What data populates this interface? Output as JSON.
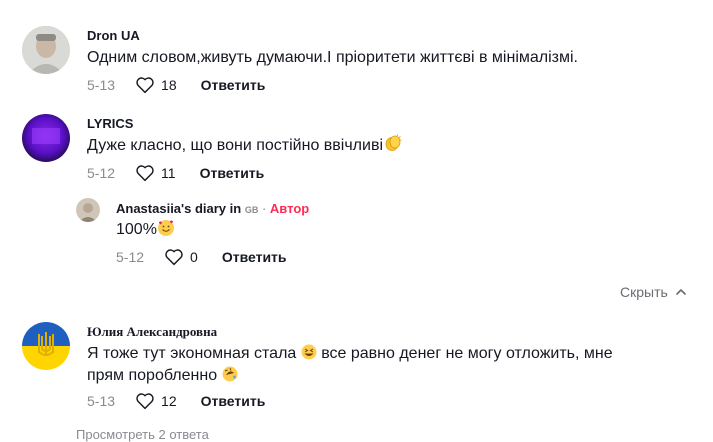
{
  "comments": [
    {
      "name": "Dron UA",
      "text": "Одним словом,живуть думаючи.І пріоритети життєві в мінімалізмі.",
      "date": "5-13",
      "likes": "18",
      "reply_label": "Ответить"
    },
    {
      "name": "LYRICS",
      "text": "Дуже класно, що вони постійно ввічливі",
      "date": "5-12",
      "likes": "11",
      "reply_label": "Ответить",
      "replies": [
        {
          "name": "Anastasiia's diary in",
          "flag": "GB",
          "separator": "·",
          "author_tag": "Автор",
          "text": "100%",
          "date": "5-12",
          "likes": "0",
          "reply_label": "Ответить"
        }
      ]
    },
    {
      "name": "Юлия Александровна",
      "text_line1_a": "Я тоже тут экономная стала",
      "text_line1_b": "все равно денег не могу отложить, мне",
      "text_line2": "прям поробленно",
      "date": "5-13",
      "likes": "12",
      "reply_label": "Ответить"
    }
  ],
  "hide_label": "Скрыть",
  "more_replies_label": "Просмотреть 2 ответа",
  "colors": {
    "author": "#fe2c55",
    "muted": "#8a8b91",
    "text": "#161823"
  },
  "icons": [
    "heart-outline-icon",
    "chevron-up-icon",
    "clapping-hands-emoji",
    "smiling-hearts-emoji",
    "grinning-squint-emoji",
    "rolling-laughing-emoji"
  ]
}
